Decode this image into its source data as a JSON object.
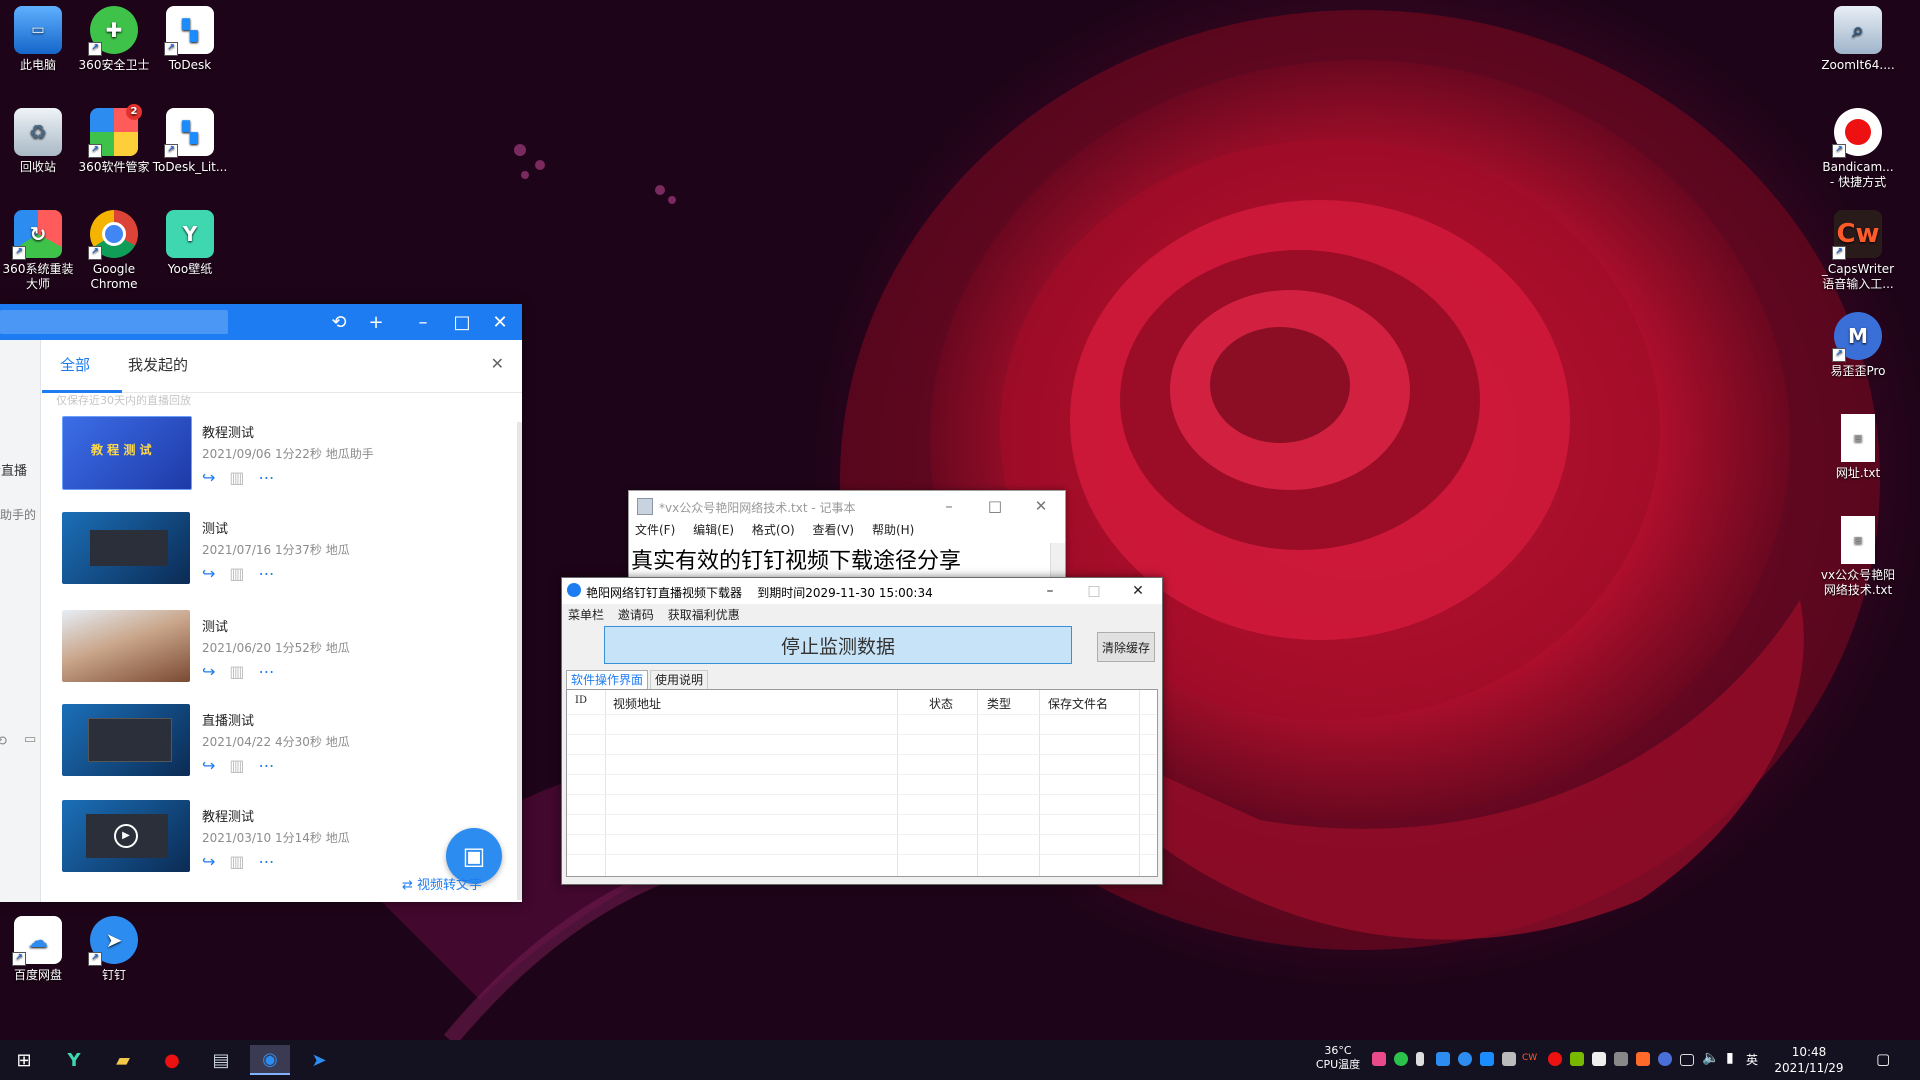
{
  "desktop": {
    "icons_left": [
      {
        "label": "此电脑",
        "icon": "computer-icon"
      },
      {
        "label": "360安全卫士",
        "icon": "360-safe-icon"
      },
      {
        "label": "ToDesk",
        "icon": "todesk-icon"
      },
      {
        "label": "回收站",
        "icon": "recycle-bin-icon"
      },
      {
        "label": "360软件管家",
        "icon": "360-software-icon"
      },
      {
        "label": "ToDesk_Lit...",
        "icon": "todesk-lite-icon"
      },
      {
        "label": "360系统重装大师",
        "icon": "360-reinstall-icon"
      },
      {
        "label": "Google Chrome",
        "icon": "chrome-icon"
      },
      {
        "label": "Yoo壁纸",
        "icon": "yoo-wallpaper-icon"
      },
      {
        "label": "百度网盘",
        "icon": "baidu-netdisk-icon"
      },
      {
        "label": "钉钉",
        "icon": "dingtalk-icon"
      }
    ],
    "icons_right": [
      {
        "label": "ZoomIt64....",
        "icon": "zoomit-icon"
      },
      {
        "label": "Bandicam... - 快捷方式",
        "icon": "bandicam-icon"
      },
      {
        "label": "_CapsWriter 语音输入工...",
        "icon": "capswriter-icon"
      },
      {
        "label": "易歪歪Pro",
        "icon": "yiwaiwai-icon"
      },
      {
        "label": "网址.txt",
        "icon": "text-file-icon"
      },
      {
        "label": "vx公众号艳阳网络技术.txt",
        "icon": "text-file-icon"
      }
    ],
    "cw_glyph": "Cw",
    "badge_count": "2"
  },
  "dingtalk": {
    "tabs": [
      "全部",
      "我发起的"
    ],
    "left_labels": [
      "看直播",
      "瓜助手的"
    ],
    "faded_text": "仅保存近30天内的直播回放",
    "items": [
      {
        "title": "教程测试",
        "meta": "2021/09/06 1分22秒 地瓜助手",
        "thumb_text": "教 程 测 试"
      },
      {
        "title": "测试",
        "meta": "2021/07/16 1分37秒 地瓜"
      },
      {
        "title": "测试",
        "meta": "2021/06/20 1分52秒 地瓜"
      },
      {
        "title": "直播测试",
        "meta": "2021/04/22 4分30秒 地瓜"
      },
      {
        "title": "教程测试",
        "meta": "2021/03/10 1分14秒 地瓜"
      }
    ],
    "video_to_text": "视频转文字"
  },
  "notepad": {
    "title": "*vx公众号艳阳网络技术.txt - 记事本",
    "menu": [
      "文件(F)",
      "编辑(E)",
      "格式(O)",
      "查看(V)",
      "帮助(H)"
    ],
    "content": "真实有效的钉钉视频下载途径分享"
  },
  "downloader": {
    "title": "艳阳网络钉钉直播视频下载器",
    "expire": "到期时间2029-11-30 15:00:34",
    "menu": [
      "菜单栏",
      "邀请码",
      "获取福利优惠"
    ],
    "stop_button": "停止监测数据",
    "clear_button": "清除缓存",
    "tabs": [
      "软件操作界面",
      "使用说明"
    ],
    "columns": [
      "ID",
      "视频地址",
      "状态",
      "类型",
      "保存文件名"
    ]
  },
  "taskbar": {
    "temperature": "36°C",
    "cpu_label": "CPU温度",
    "cw_small": "CW",
    "ime": "英",
    "time": "10:48",
    "date": "2021/11/29"
  }
}
